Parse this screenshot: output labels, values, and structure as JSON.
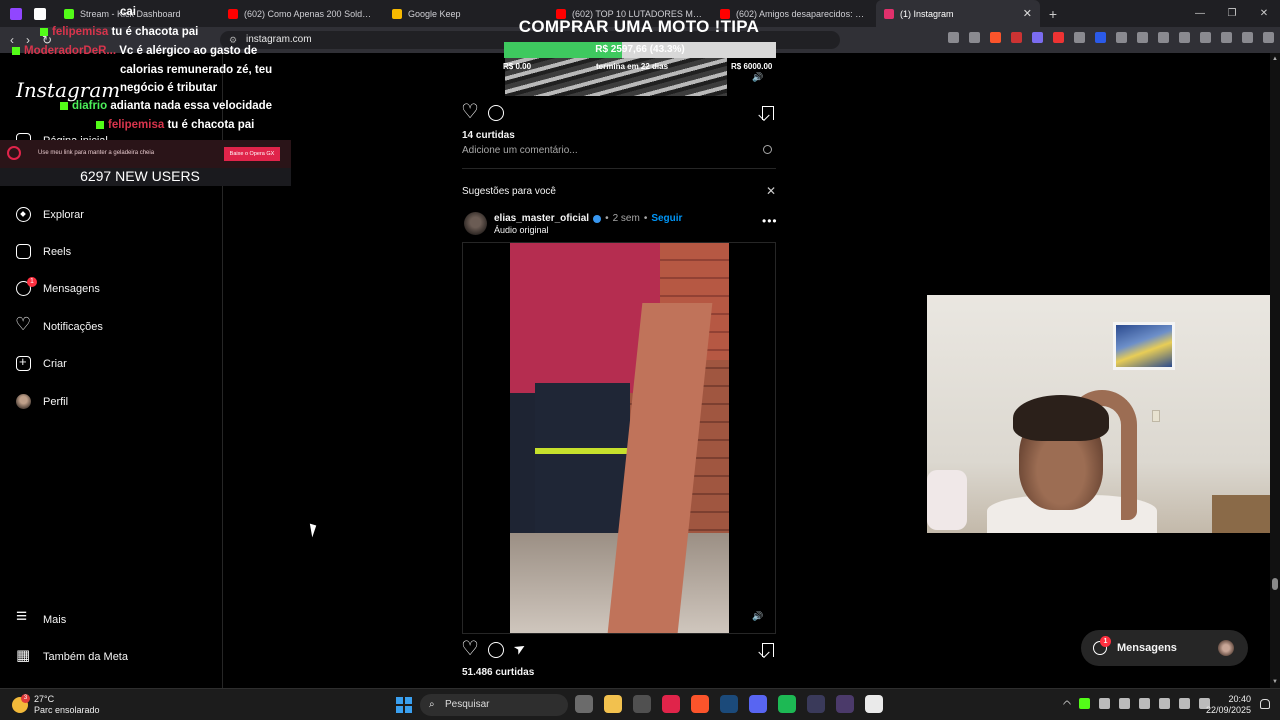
{
  "browser": {
    "tabs": [
      {
        "label": "Stream - Kick Dashboard",
        "favicon_color": "#53fc18"
      },
      {
        "label": "(602) Como Apenas 200 Soldados De",
        "favicon_color": "#ff0000"
      },
      {
        "label": "Google Keep",
        "favicon_color": "#f7b900"
      },
      {
        "label": "(602) TOP 10 LUTADORES MAIS ODI",
        "favicon_color": "#ff0000"
      },
      {
        "label": "(602) Amigos desaparecidos: polícia",
        "favicon_color": "#ff0000"
      },
      {
        "label": "(1) Instagram",
        "favicon_color": "#e1306c"
      }
    ],
    "url": "instagram.com"
  },
  "chat": [
    {
      "user": "",
      "text": "cai"
    },
    {
      "user": "felipemisa",
      "text": "tu é chacota pai"
    },
    {
      "user": "ModeradorDeR...",
      "text": "Vc é alérgico ao gasto de"
    },
    {
      "user": "",
      "text": "calorias remunerado zé, teu"
    },
    {
      "user": "",
      "text": "negócio é tributar"
    },
    {
      "user": "diafrio",
      "text": "adianta nada essa velocidade"
    },
    {
      "user": "felipemisa",
      "text": "tu é chacota pai"
    }
  ],
  "banner": {
    "text": "Use meu link para manter a geladeira cheia",
    "button": "Baixe o Opera GX",
    "users": "6297 NEW USERS"
  },
  "goal": {
    "title": "COMPRAR UMA MOTO !TIPA",
    "amount": "R$ 2597,66 (43.3%)",
    "progress_fraction": 0.433,
    "min": "R$ 0.00",
    "days_left": "termina em 22 dias",
    "max": "R$ 6000.00"
  },
  "instagram": {
    "logo": "Instagram",
    "nav": [
      {
        "label": "Página inicial"
      },
      {
        "label": "Explorar"
      },
      {
        "label": "Reels"
      },
      {
        "label": "Mensagens",
        "badge": "1"
      },
      {
        "label": "Notificações"
      },
      {
        "label": "Criar"
      },
      {
        "label": "Perfil"
      },
      {
        "label": "Mais"
      },
      {
        "label": "Também da Meta"
      }
    ],
    "post1": {
      "likes": "14 curtidas",
      "comment_placeholder": "Adicione um comentário..."
    },
    "suggestions_title": "Sugestões para você",
    "post2": {
      "username": "elias_master_oficial",
      "time": "2 sem",
      "follow": "Seguir",
      "audio": "Áudio original",
      "likes": "51.486 curtidas"
    },
    "messages_pill": {
      "label": "Mensagens",
      "badge": "1"
    }
  },
  "taskbar": {
    "weather_temp": "27°C",
    "weather_desc": "Parc ensolarado",
    "weather_badge": "3",
    "search_label": "Pesquisar",
    "time": "20:40",
    "date": "22/09/2025"
  }
}
